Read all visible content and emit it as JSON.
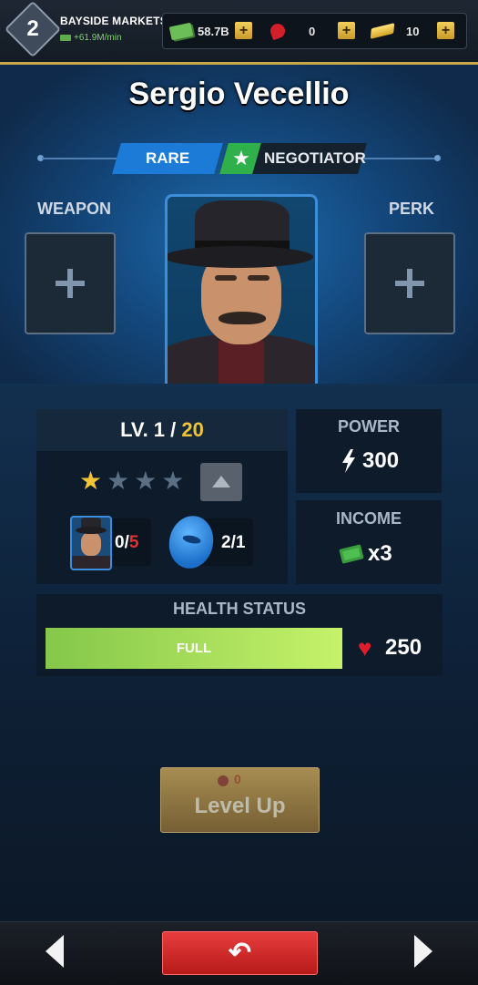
{
  "topbar": {
    "player_level": "2",
    "district_name": "BAYSIDE MARKETS",
    "income_rate": "+61.9M/min",
    "resources": [
      {
        "name": "cash",
        "icon": "cash-icon",
        "value": "58.7B"
      },
      {
        "name": "rose",
        "icon": "rose-icon",
        "value": "0"
      },
      {
        "name": "gold",
        "icon": "gold-bar-icon",
        "value": "10"
      }
    ]
  },
  "character": {
    "name": "Sergio Vecellio",
    "rarity": "RARE",
    "role": "NEGOTIATOR",
    "weapon_label": "WEAPON",
    "perk_label": "PERK"
  },
  "level": {
    "prefix": "LV. 1 /",
    "max": " 20",
    "stars_filled": 1,
    "stars_total": 4,
    "duplicates_have": "0/",
    "duplicates_need": "5",
    "tokens": "2/1"
  },
  "power": {
    "label": "POWER",
    "value": "300"
  },
  "income": {
    "label": "INCOME",
    "value": "x3"
  },
  "health": {
    "label": "HEALTH STATUS",
    "status": "FULL",
    "fill_fraction": 1.0,
    "value": "250"
  },
  "actions": {
    "level_up_label": "Level Up",
    "level_up_cost": "0"
  },
  "colors": {
    "rarity_blue": "#1b7bd6",
    "health_green": "#9edb55",
    "back_red": "#d42a2a",
    "accent_gold": "#f0c534"
  }
}
